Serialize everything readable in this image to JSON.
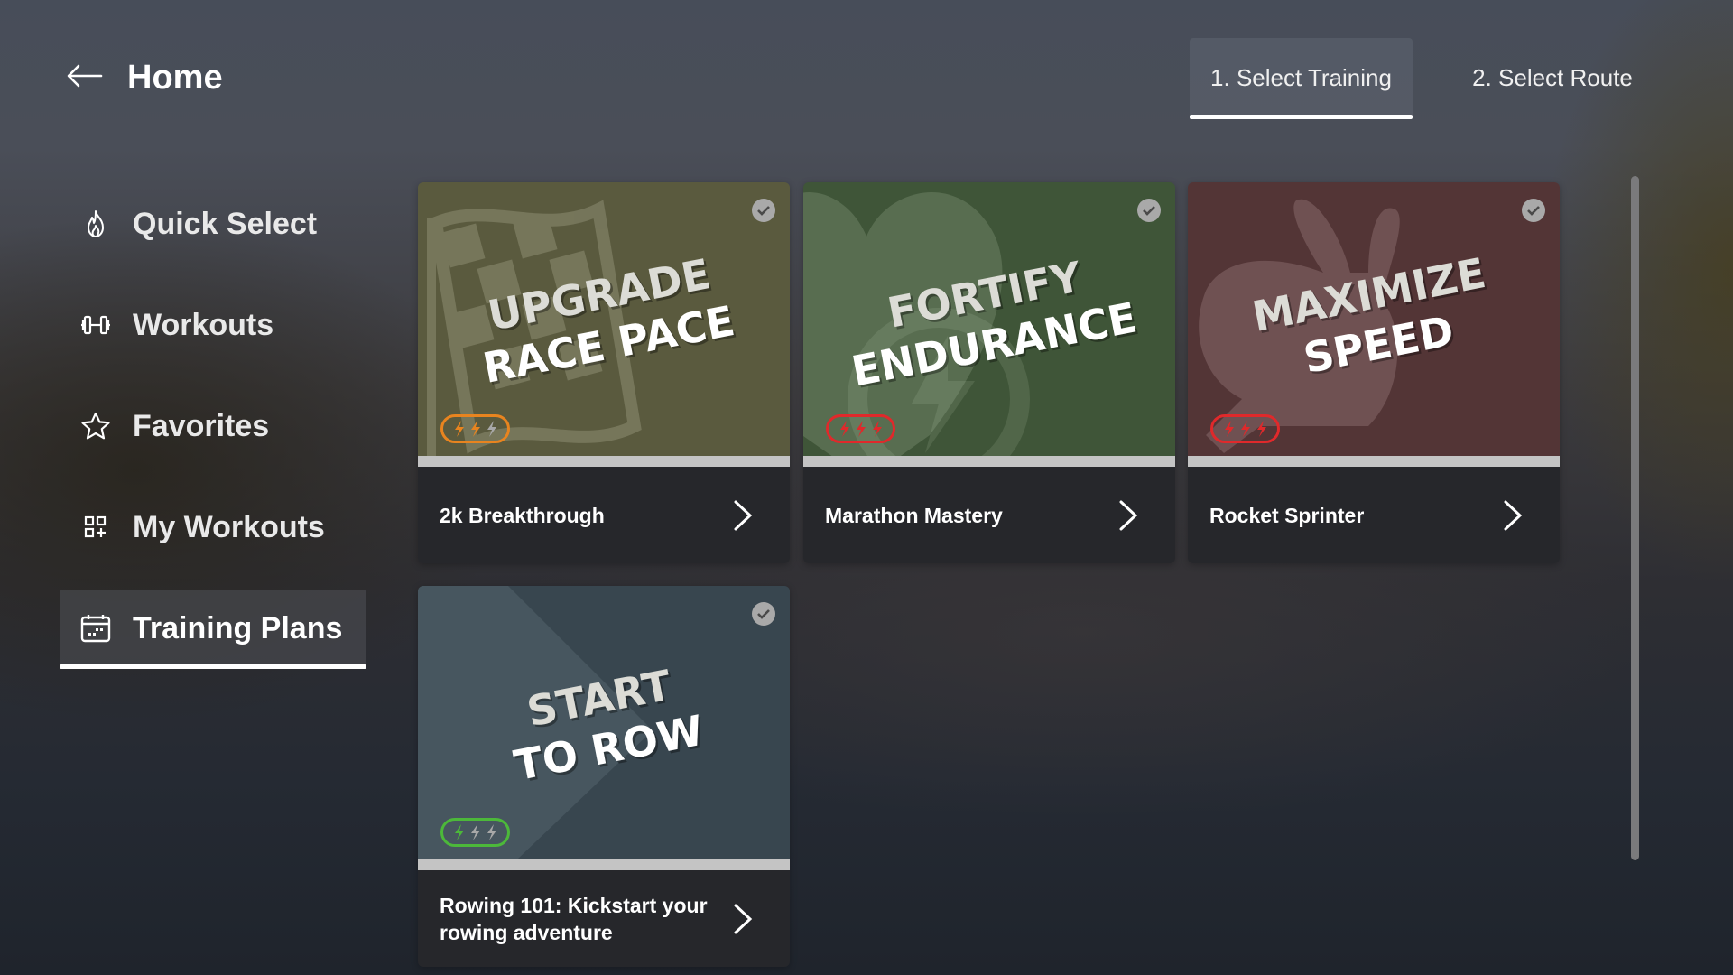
{
  "header": {
    "back_icon": "arrow-left-icon",
    "title": "Home"
  },
  "steps": [
    {
      "label": "1. Select Training",
      "active": true
    },
    {
      "label": "2. Select Route",
      "active": false
    }
  ],
  "sidebar": {
    "items": [
      {
        "label": "Quick Select",
        "icon": "flame-icon",
        "active": false
      },
      {
        "label": "Workouts",
        "icon": "dumbbell-icon",
        "active": false
      },
      {
        "label": "Favorites",
        "icon": "star-icon",
        "active": false
      },
      {
        "label": "My Workouts",
        "icon": "grid-plus-icon",
        "active": false
      },
      {
        "label": "Training Plans",
        "icon": "calendar-icon",
        "active": true
      }
    ]
  },
  "plans": [
    {
      "name": "2k Breakthrough",
      "headline": [
        "UPGRADE",
        "RACE PACE"
      ],
      "art_icon": "checkered-flag-icon",
      "bg_color": "#5a5a3e",
      "intensity": 2,
      "intensity_max": 3,
      "intensity_color": "#e8841f",
      "completed_check": true
    },
    {
      "name": "Marathon Mastery",
      "headline": [
        "FORTIFY",
        "ENDURANCE"
      ],
      "art_icon": "heart-bolt-icon",
      "bg_color": "#3f5538",
      "intensity": 3,
      "intensity_max": 3,
      "intensity_color": "#e0292b",
      "completed_check": true
    },
    {
      "name": "Rocket Sprinter",
      "headline": [
        "MAXIMIZE",
        "SPEED"
      ],
      "art_icon": "rabbit-icon",
      "bg_color": "#533536",
      "intensity": 3,
      "intensity_max": 3,
      "intensity_color": "#e0292b",
      "completed_check": true
    },
    {
      "name": "Rowing 101: Kickstart your rowing adventure",
      "headline": [
        "START",
        "TO ROW"
      ],
      "art_icon": "play-triangle-icon",
      "bg_color": "#38464f",
      "intensity": 1,
      "intensity_max": 3,
      "intensity_color": "#4cb83a",
      "completed_check": true
    }
  ],
  "colors": {
    "inactive_bolt": "#a8a8a8",
    "card_footer": "#26272b",
    "progress_bar": "#c4c4c4"
  }
}
